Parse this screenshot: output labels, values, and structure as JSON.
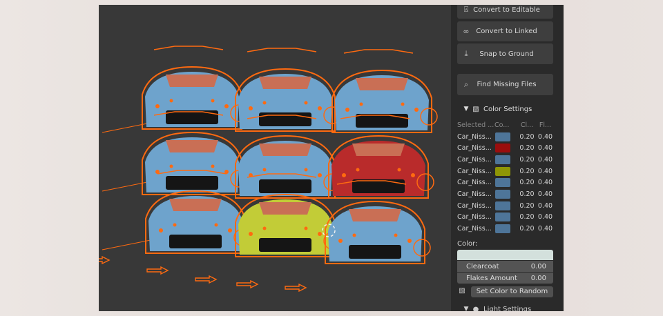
{
  "buttons": [
    {
      "label": "Convert to Editable",
      "icon": "lightbulb-icon",
      "glyph": "⍓"
    },
    {
      "label": "Convert to Linked",
      "icon": "link-icon",
      "glyph": "∞"
    },
    {
      "label": "Snap to Ground",
      "icon": "download-icon",
      "glyph": "⤓"
    },
    {
      "label": "Find Missing Files",
      "icon": "file-search-icon",
      "glyph": "⌕"
    }
  ],
  "color_settings": {
    "title": "Color Settings",
    "icon": "car-paint-icon",
    "columns": [
      "Selected ...",
      "Co...",
      "Cl...",
      "Fl..."
    ],
    "rows": [
      {
        "name": "Car_Niss...",
        "color": "#4e7599",
        "clearcoat": "0.20",
        "flakes": "0.40"
      },
      {
        "name": "Car_Niss...",
        "color": "#9a0d0d",
        "clearcoat": "0.20",
        "flakes": "0.40"
      },
      {
        "name": "Car_Niss...",
        "color": "#4e7599",
        "clearcoat": "0.20",
        "flakes": "0.40"
      },
      {
        "name": "Car_Niss...",
        "color": "#8f9606",
        "clearcoat": "0.20",
        "flakes": "0.40"
      },
      {
        "name": "Car_Niss...",
        "color": "#4e7599",
        "clearcoat": "0.20",
        "flakes": "0.40"
      },
      {
        "name": "Car_Niss...",
        "color": "#4e7599",
        "clearcoat": "0.20",
        "flakes": "0.40"
      },
      {
        "name": "Car_Niss...",
        "color": "#4e7599",
        "clearcoat": "0.20",
        "flakes": "0.40"
      },
      {
        "name": "Car_Niss...",
        "color": "#4e7599",
        "clearcoat": "0.20",
        "flakes": "0.40"
      },
      {
        "name": "Car_Niss...",
        "color": "#4e7599",
        "clearcoat": "0.20",
        "flakes": "0.40"
      }
    ],
    "color_label": "Color:",
    "color_value": "#d3e0dc",
    "clearcoat_label": "Clearcoat",
    "clearcoat_value": "0.00",
    "flakes_label": "Flakes Amount",
    "flakes_value": "0.00",
    "random_button": "Set Color to Random"
  },
  "light_settings": {
    "title": "Light Settings"
  },
  "viewport": {
    "cars": [
      {
        "color": "#6ea3cc"
      },
      {
        "color": "#6ea3cc"
      },
      {
        "color": "#6ea3cc"
      },
      {
        "color": "#6ea3cc"
      },
      {
        "color": "#6ea3cc"
      },
      {
        "color": "#b92b2b"
      },
      {
        "color": "#6ea3cc"
      },
      {
        "color": "#c2cc37"
      },
      {
        "color": "#6ea3cc"
      }
    ],
    "outline_color": "#ff6a10"
  }
}
